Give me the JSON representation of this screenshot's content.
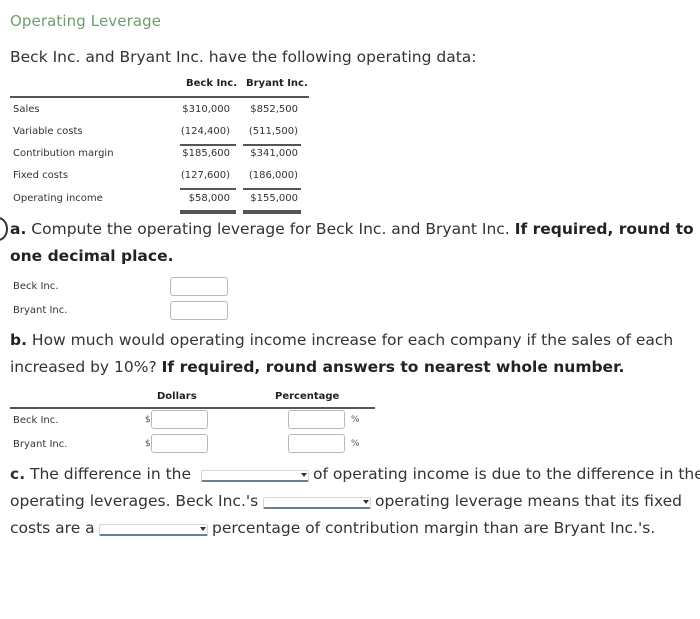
{
  "title": "Operating Leverage",
  "intro": "Beck Inc. and Bryant Inc. have the following operating data:",
  "data_table": {
    "columns": [
      "Beck Inc.",
      "Bryant Inc."
    ],
    "rows": [
      {
        "label": "Sales",
        "beck": "$310,000",
        "bryant": "$852,500"
      },
      {
        "label": "Variable costs",
        "beck": "(124,400)",
        "bryant": "(511,500)"
      },
      {
        "label": "Contribution margin",
        "beck": "$185,600",
        "bryant": "$341,000"
      },
      {
        "label": "Fixed costs",
        "beck": "(127,600)",
        "bryant": "(186,000)"
      },
      {
        "label": "Operating income",
        "beck": "$58,000",
        "bryant": "$155,000"
      }
    ]
  },
  "part_a": {
    "letter": "a.",
    "text": "Compute the operating leverage for Beck Inc. and Bryant Inc.",
    "bold_line1": "If required, round to",
    "bold_line2": "one decimal place.",
    "rows": [
      {
        "label": "Beck Inc.",
        "value": ""
      },
      {
        "label": "Bryant Inc.",
        "value": ""
      }
    ]
  },
  "part_b": {
    "letter": "b.",
    "line1": "How much would operating income increase for each company if the sales of each",
    "line2_plain": "increased by 10%?",
    "line2_bold": "If required, round answers to nearest whole number.",
    "col_dollars": "Dollars",
    "col_percentage": "Percentage",
    "currency_symbol": "$",
    "percent_symbol": "%",
    "rows": [
      {
        "label": "Beck Inc.",
        "dollars": "",
        "percentage": ""
      },
      {
        "label": "Bryant Inc.",
        "dollars": "",
        "percentage": ""
      }
    ]
  },
  "part_c": {
    "letter": "c.",
    "seg1": "The difference in the",
    "seg2": "of operating income is due to the difference in the",
    "seg3": "operating leverages. Beck Inc.'s",
    "seg4": "operating leverage means that its fixed",
    "seg5": "costs are a",
    "seg6": "percentage of contribution margin than are Bryant Inc.'s.",
    "dropdowns": [
      {
        "selected": ""
      },
      {
        "selected": ""
      },
      {
        "selected": ""
      }
    ]
  }
}
